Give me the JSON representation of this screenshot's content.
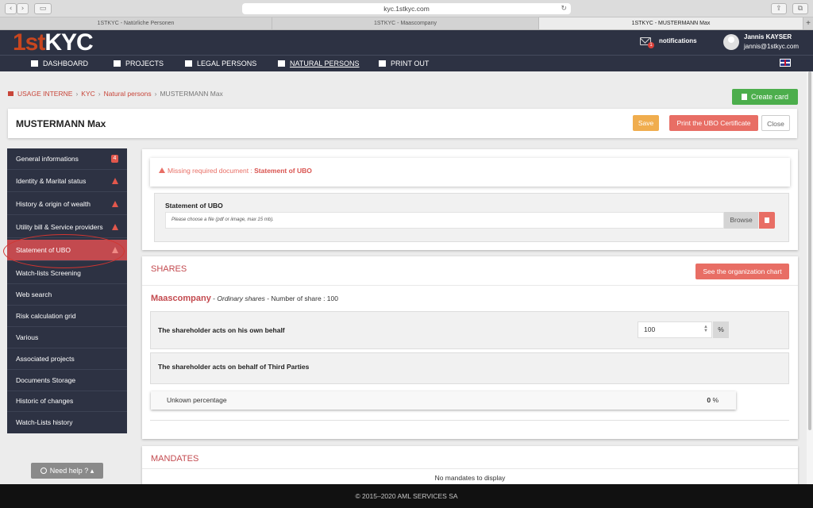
{
  "browser": {
    "url": "kyc.1stkyc.com",
    "tabs": [
      {
        "label": "1STKYC - Natürliche Personen",
        "active": false
      },
      {
        "label": "1STKYC - Maascompany",
        "active": false
      },
      {
        "label": "1STKYC - MUSTERMANN Max",
        "active": true
      }
    ]
  },
  "header": {
    "logo_part1": "1st",
    "logo_part2": "KYC",
    "notifications_label": "notifications",
    "notifications_count": "1",
    "user_name": "Jannis KAYSER",
    "user_email": "jannis@1stkyc.com",
    "language_flag": "uk-flag-icon"
  },
  "nav": {
    "items": [
      {
        "label": "DASHBOARD",
        "icon": "chart-icon"
      },
      {
        "label": "PROJECTS",
        "icon": "folder-icon"
      },
      {
        "label": "LEGAL PERSONS",
        "icon": "building-icon"
      },
      {
        "label": "NATURAL PERSONS",
        "icon": "user-icon",
        "active": true
      },
      {
        "label": "PRINT OUT",
        "icon": "file-icon"
      }
    ]
  },
  "breadcrumb": {
    "items": [
      "USAGE INTERNE",
      "KYC",
      "Natural persons"
    ],
    "current": "MUSTERMANN Max",
    "separator": "›"
  },
  "actions": {
    "create_card": "Create card",
    "save": "Save",
    "print_ubo": "Print the UBO Certificate",
    "close": "Close"
  },
  "page": {
    "title": "MUSTERMANN Max"
  },
  "sidebar": {
    "items": [
      {
        "label": "General informations",
        "badge": "4"
      },
      {
        "label": "Identity & Marital status",
        "warning": true
      },
      {
        "label": "History & origin of wealth",
        "warning": true
      },
      {
        "label": "Utility bill & Service providers",
        "warning": true
      },
      {
        "label": "Statement of UBO",
        "warning": true,
        "active": true
      },
      {
        "label": "Watch-lists Screening"
      },
      {
        "label": "Web search"
      },
      {
        "label": "Risk calculation grid"
      },
      {
        "label": "Various"
      },
      {
        "label": "Associated projects"
      },
      {
        "label": "Documents Storage"
      },
      {
        "label": "Historic of changes"
      },
      {
        "label": "Watch-Lists history"
      }
    ],
    "need_help": "Need help ?"
  },
  "ubo": {
    "alert_prefix": "Missing required document : ",
    "alert_doc": "Statement of UBO",
    "doc_label": "Statement of UBO",
    "file_placeholder": "Please choose a file (pdf or iimage, max 15 mb).",
    "browse": "Browse"
  },
  "shares": {
    "heading": "SHARES",
    "org_chart_btn": "See the organization chart",
    "company": "Maascompany",
    "share_type": "Ordinary shares",
    "share_count_label": "Number of share : ",
    "share_count": "100",
    "own_behalf_label": "The shareholder acts on his own behalf",
    "own_behalf_value": "100",
    "percent_sign": "%",
    "third_parties_label": "The shareholder acts on behalf of Third Parties",
    "unknown_label": "Unkown percentage",
    "unknown_value": "0",
    "unknown_unit": "%"
  },
  "mandates": {
    "heading": "MANDATES",
    "empty": "No mandates to display"
  },
  "footer": {
    "text": "© 2015–2020 AML SERVICES SA"
  },
  "colors": {
    "navy": "#2d3243",
    "accent_red": "#c34a4f",
    "button_red": "#e86e65",
    "save_orange": "#f0ad4e",
    "create_green": "#4cae4c"
  }
}
